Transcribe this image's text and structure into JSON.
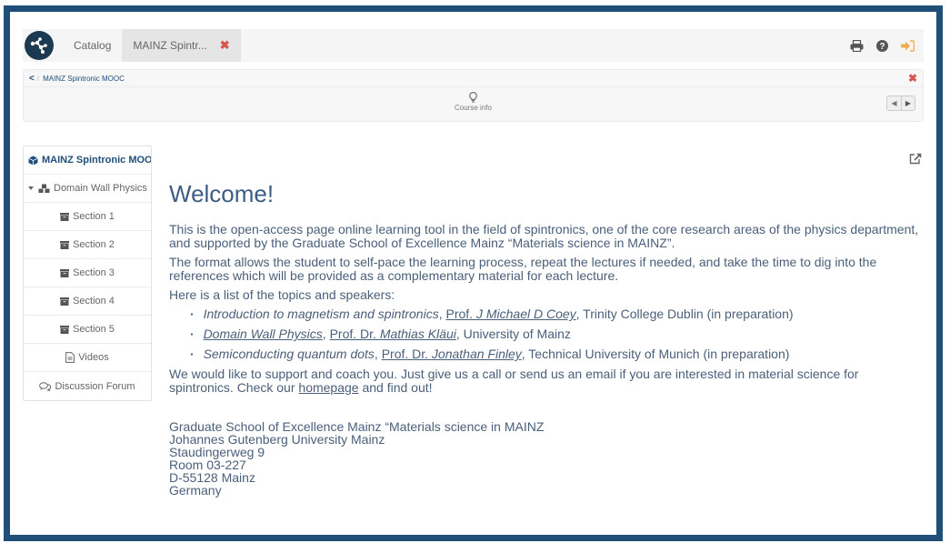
{
  "topbar": {
    "tabs": [
      {
        "label": "Catalog"
      },
      {
        "label": "MAINZ Spintr...",
        "close": "✖"
      }
    ],
    "icons": [
      "print-icon",
      "help-icon",
      "sign-out-icon"
    ],
    "colors": {
      "brand": "#1b3a52",
      "close": "#d9534f",
      "signout": "#f0ad4e",
      "frame": "#1f4e79"
    }
  },
  "breadcrumb": {
    "back": "<",
    "separator": "/",
    "course": "MAINZ Spintronic MOOC",
    "close": "✖"
  },
  "course_info": {
    "label": "Course info",
    "prev": "◀",
    "next": "▶"
  },
  "sidebar": {
    "header": "MAINZ Spintronic MOOC",
    "chapter": "Domain Wall Physics",
    "sections": [
      "Section 1",
      "Section 2",
      "Section 3",
      "Section 4",
      "Section 5"
    ],
    "videos": "Videos",
    "forum": "Discussion Forum"
  },
  "content": {
    "title": "Welcome!",
    "p1": "This is the open-access page online learning tool in the field of spintronics, one of the core research areas of the physics department, and supported by the Graduate School of Excellence Mainz “Materials science in MAINZ”.",
    "p2": "The format allows the student to self-pace the learning process, repeat the lectures if needed, and take the time to dig into the references which will be provided as a complementary material for each lecture.",
    "p3": "Here is a list of the topics and speakers:",
    "topics": [
      {
        "topic": "Introduction to magnetism and spintronics",
        "sep1": ", ",
        "prof_prefix": "Prof. ",
        "speaker": "J Michael D Coey",
        "rest": ", Trinity College Dublin (in preparation)"
      },
      {
        "topic": "Domain Wall Physics",
        "sep1": ", ",
        "prof_prefix": "Prof. Dr. ",
        "speaker": "Mathias Kläui",
        "rest": ", University of Mainz"
      },
      {
        "topic": "Semiconducting quantum dots",
        "sep1": ", ",
        "prof_prefix": "Prof. Dr. ",
        "speaker": "Jonathan Finley",
        "rest": ", Technical University of Munich (in preparation)"
      }
    ],
    "p4_before": "We would like to support and coach you. Just give us a call or send us an email if you are interested in material science for spintronics. Check our ",
    "p4_link": "homepage",
    "p4_after": " and find out!",
    "address": [
      "Graduate School of Excellence Mainz “Materials science in MAINZ",
      "Johannes Gutenberg University Mainz",
      "Staudingerweg 9",
      "Room 03-227",
      "D-55128 Mainz",
      "Germany"
    ]
  }
}
